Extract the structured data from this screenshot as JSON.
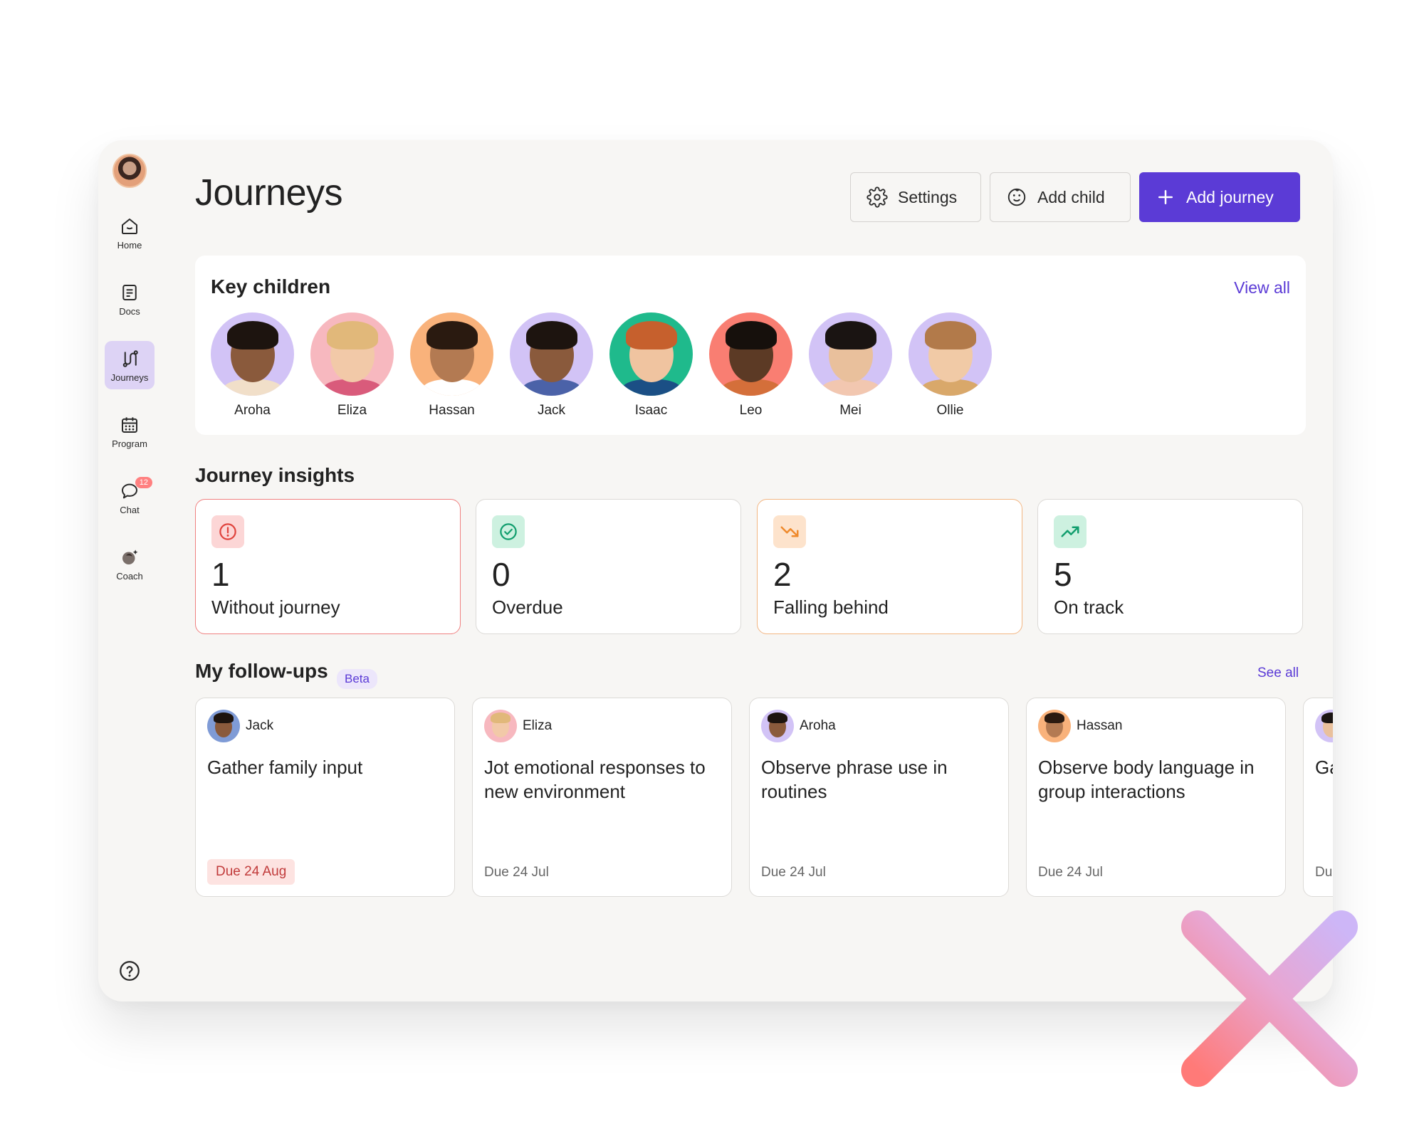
{
  "sidebar": {
    "items": [
      {
        "label": "Home",
        "icon": "home-icon"
      },
      {
        "label": "Docs",
        "icon": "docs-icon"
      },
      {
        "label": "Journeys",
        "icon": "journeys-icon",
        "active": true
      },
      {
        "label": "Program",
        "icon": "calendar-icon"
      },
      {
        "label": "Chat",
        "icon": "chat-icon",
        "badge": "12"
      },
      {
        "label": "Coach",
        "icon": "coach-icon"
      }
    ]
  },
  "header": {
    "title": "Journeys",
    "settings_label": "Settings",
    "add_child_label": "Add child",
    "add_journey_label": "Add journey"
  },
  "key_children": {
    "title": "Key children",
    "view_all": "View all",
    "children": [
      {
        "name": "Aroha",
        "bg": "#d2c3f6"
      },
      {
        "name": "Eliza",
        "bg": "#f7b8bf"
      },
      {
        "name": "Hassan",
        "bg": "#f9b27b"
      },
      {
        "name": "Jack",
        "bg": "#d2c3f6"
      },
      {
        "name": "Isaac",
        "bg": "#1fba8c"
      },
      {
        "name": "Leo",
        "bg": "#f97e72"
      },
      {
        "name": "Mei",
        "bg": "#d2c3f6"
      },
      {
        "name": "Ollie",
        "bg": "#d2c3f6"
      }
    ]
  },
  "insights": {
    "title": "Journey insights",
    "cards": [
      {
        "count": "1",
        "label": "Without journey",
        "icon": "alert-circle-icon",
        "tone": "red"
      },
      {
        "count": "0",
        "label": "Overdue",
        "icon": "check-circle-icon",
        "tone": "green"
      },
      {
        "count": "2",
        "label": "Falling behind",
        "icon": "trend-down-icon",
        "tone": "orange"
      },
      {
        "count": "5",
        "label": "On track",
        "icon": "trend-up-icon",
        "tone": "green"
      }
    ]
  },
  "followups": {
    "title": "My follow-ups",
    "badge": "Beta",
    "see_all": "See all",
    "items": [
      {
        "child": "Jack",
        "title": "Gather family input",
        "due": "Due 24 Aug",
        "overdue": true
      },
      {
        "child": "Eliza",
        "title": "Jot emotional responses to new environment",
        "due": "Due 24 Jul",
        "overdue": false
      },
      {
        "child": "Aroha",
        "title": "Observe phrase use in routines",
        "due": "Due 24 Jul",
        "overdue": false
      },
      {
        "child": "Hassan",
        "title": "Observe body language in group interactions",
        "due": "Due 24 Jul",
        "overdue": false
      },
      {
        "child": "",
        "title": "Gat",
        "due": "Due",
        "overdue": false
      }
    ]
  },
  "colors": {
    "accent": "#5b3bd6",
    "background": "#f7f6f4",
    "danger": "#f08080",
    "warning": "#f3b683",
    "success": "#1fba8c"
  }
}
